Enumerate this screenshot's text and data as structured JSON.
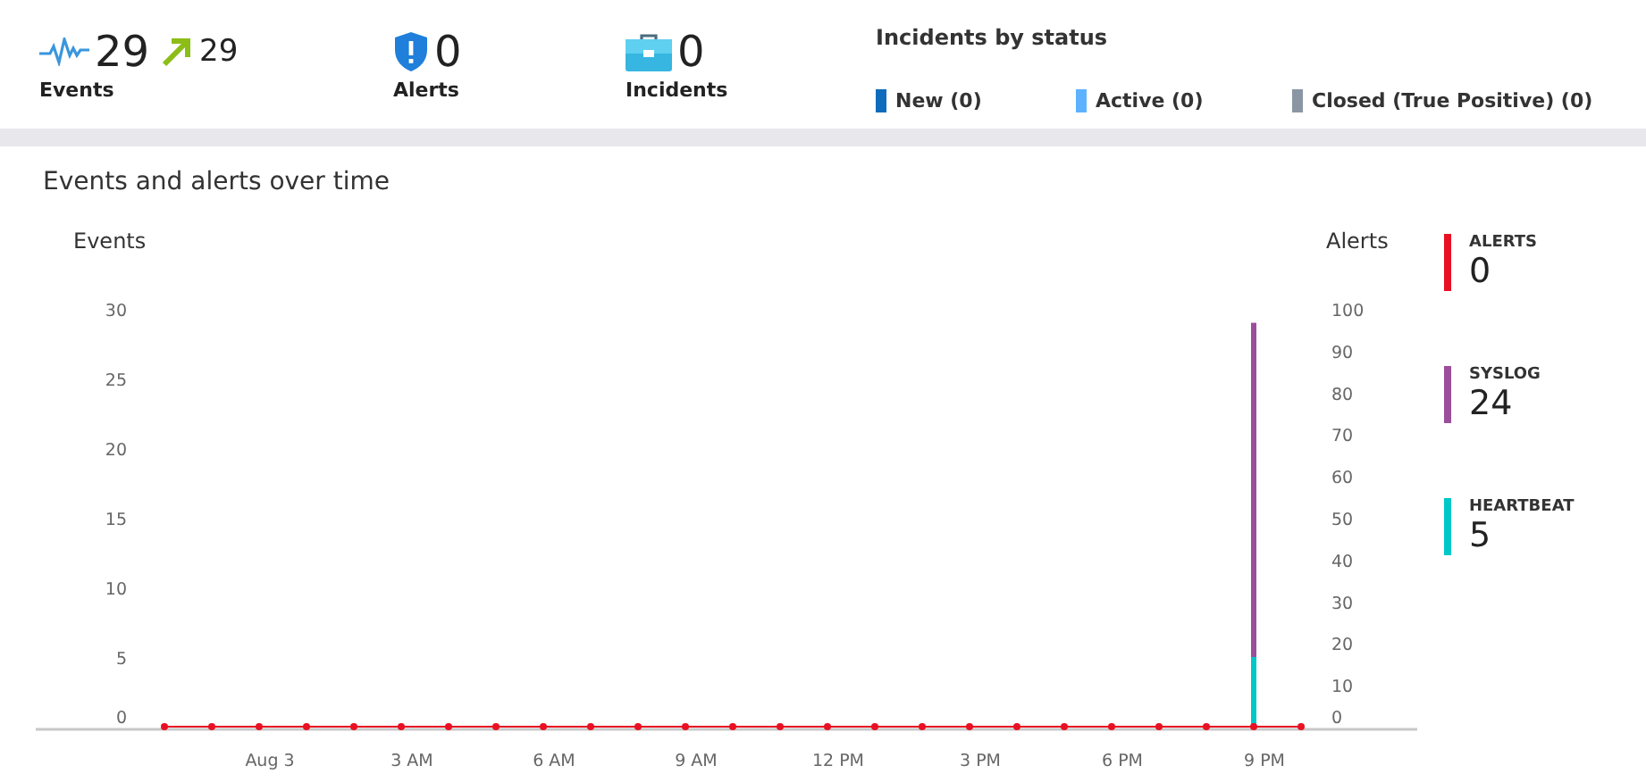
{
  "summary": [
    {
      "kind": "events",
      "value": "29",
      "trend": "29",
      "label": "Events"
    },
    {
      "kind": "alerts",
      "value": "0",
      "label": "Alerts"
    },
    {
      "kind": "incidents",
      "value": "0",
      "label": "Incidents"
    }
  ],
  "incidents_by_status": {
    "title": "Incidents by status",
    "items": [
      {
        "label": "New (0)",
        "color": "#0f6cbd"
      },
      {
        "label": "Active (0)",
        "color": "#5db2ff"
      },
      {
        "label": "Closed (True Positive) (0)",
        "color": "#8a96a3"
      }
    ]
  },
  "timeline": {
    "title": "Events and alerts over time",
    "chart_data": {
      "type": "bar",
      "stacked": true,
      "ylabel": "Events",
      "y2label": "Alerts",
      "categories": [
        null,
        null,
        "Aug 3",
        null,
        null,
        "3 AM",
        null,
        null,
        "6 AM",
        null,
        null,
        "9 AM",
        null,
        null,
        "12 PM",
        null,
        null,
        "3 PM",
        null,
        null,
        "6 PM",
        null,
        null,
        "9 PM",
        null
      ],
      "ylim": [
        0,
        30
      ],
      "yticks": [
        0,
        5,
        10,
        15,
        20,
        25,
        30
      ],
      "y2lim": [
        0,
        100
      ],
      "y2ticks": [
        0,
        10,
        20,
        30,
        40,
        50,
        60,
        70,
        80,
        90,
        100
      ],
      "series": [
        {
          "name": "ALERTS",
          "color": "#e81123",
          "axis": "y2",
          "values": [
            0,
            0,
            0,
            0,
            0,
            0,
            0,
            0,
            0,
            0,
            0,
            0,
            0,
            0,
            0,
            0,
            0,
            0,
            0,
            0,
            0,
            0,
            0,
            0,
            0
          ]
        },
        {
          "name": "SYSLOG",
          "color": "#9b4f9b",
          "values": [
            0,
            0,
            0,
            0,
            0,
            0,
            0,
            0,
            0,
            0,
            0,
            0,
            0,
            0,
            0,
            0,
            0,
            0,
            0,
            0,
            0,
            0,
            0,
            24,
            0
          ]
        },
        {
          "name": "HEARTBEAT",
          "color": "#00c8c8",
          "values": [
            0,
            0,
            0,
            0,
            0,
            0,
            0,
            0,
            0,
            0,
            0,
            0,
            0,
            0,
            0,
            0,
            0,
            0,
            0,
            0,
            0,
            0,
            0,
            5,
            0
          ]
        }
      ]
    },
    "legend_totals": [
      "0",
      "24",
      "5"
    ]
  }
}
